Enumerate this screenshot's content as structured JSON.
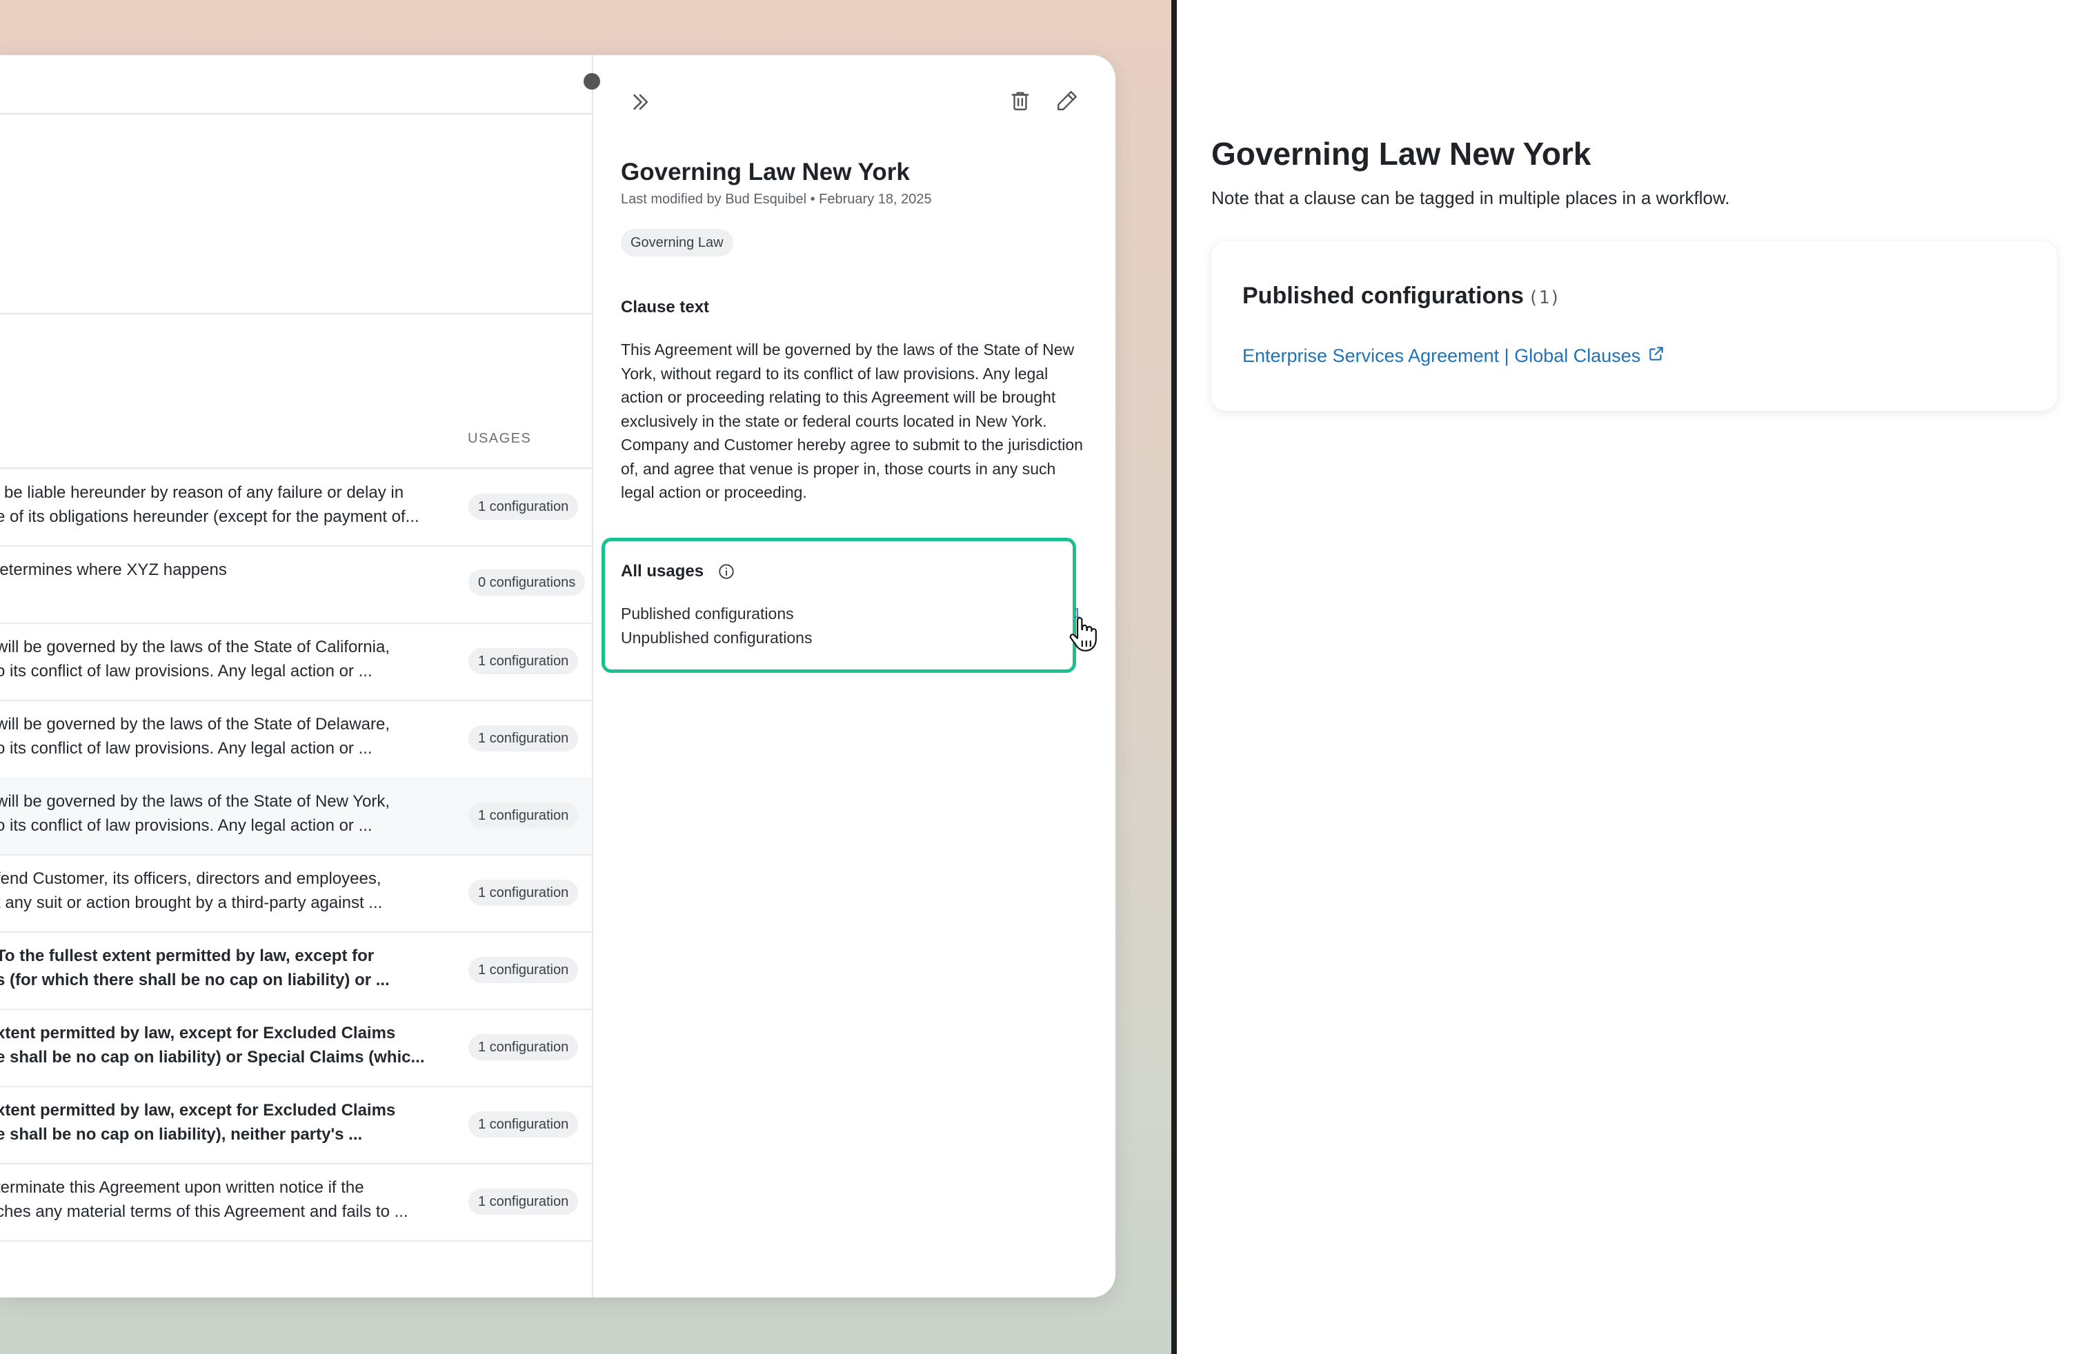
{
  "list": {
    "column_usages": "USAGES",
    "rows": [
      {
        "line1": "l be liable hereunder by reason of any failure or delay in",
        "line2": "e of its obligations hereunder (except for the payment of...",
        "usages": "1 configuration",
        "bold": false
      },
      {
        "line1": "letermines where XYZ happens",
        "line2": "",
        "usages": "0 configurations",
        "bold": false
      },
      {
        "line1": "will be governed by the laws of the State of California,",
        "line2": "o its conflict of law provisions.  Any legal action or ...",
        "usages": "1 configuration",
        "bold": false
      },
      {
        "line1": "will be governed by the laws of the State of Delaware,",
        "line2": "o its conflict of law provisions.  Any legal action or ...",
        "usages": "1 configuration",
        "bold": false
      },
      {
        "line1": "will be governed by the laws of the State of New York,",
        "line2": "o its conflict of law provisions.  Any legal action or ...",
        "usages": "1 configuration",
        "bold": false
      },
      {
        "line1": "fend Customer, its officers, directors and employees,",
        "line2": "t any suit or action brought by a third-party against ...",
        "usages": "1 configuration",
        "bold": false
      },
      {
        "line1": "To the fullest extent permitted by law, except for",
        "line2": "s (for which there shall be no cap on liability) or ...",
        "usages": "1 configuration",
        "bold": true
      },
      {
        "line1": "xtent permitted by law, except for Excluded Claims",
        "line2": "e shall be no cap on liability) or Special Claims (whic...",
        "usages": "1 configuration",
        "bold": true
      },
      {
        "line1": "xtent permitted by law, except for Excluded Claims",
        "line2": "e shall be no cap on liability), neither party's ...",
        "usages": "1 configuration",
        "bold": true
      },
      {
        "line1": " terminate this Agreement upon written notice if the",
        "line2": "ches any material terms of this Agreement and fails to ...",
        "usages": "1 configuration",
        "bold": false
      }
    ]
  },
  "detail": {
    "title": "Governing Law New York",
    "meta": "Last modified by Bud Esquibel • February 18, 2025",
    "tag": "Governing Law",
    "clause_heading": "Clause text",
    "clause_text": "This Agreement will be governed by the laws of the State of New York, without regard to its conflict of law provisions.  Any legal action or proceeding relating to this Agreement will be brought exclusively in the state or federal courts located in New York.  Company and Customer hereby agree to submit to the jurisdiction of, and agree that venue is proper in, those courts in any such legal action or proceeding.",
    "usages_title": "All usages",
    "published_label": "Published configurations",
    "published_count": "1",
    "unpublished_label": "Unpublished configurations",
    "icons": [
      "chevrons-right-icon",
      "trash-icon",
      "pencil-icon",
      "info-icon",
      "hand-cursor-icon"
    ],
    "highlight_color": "#18c18f"
  },
  "right_panel": {
    "title": "Governing Law New York",
    "subtitle": "Note that a clause can be tagged in multiple places in a workflow.",
    "card_heading": "Published configurations",
    "card_count": "(1)",
    "link_text": "Enterprise Services Agreement | Global Clauses",
    "link_color": "#1f72b8"
  }
}
